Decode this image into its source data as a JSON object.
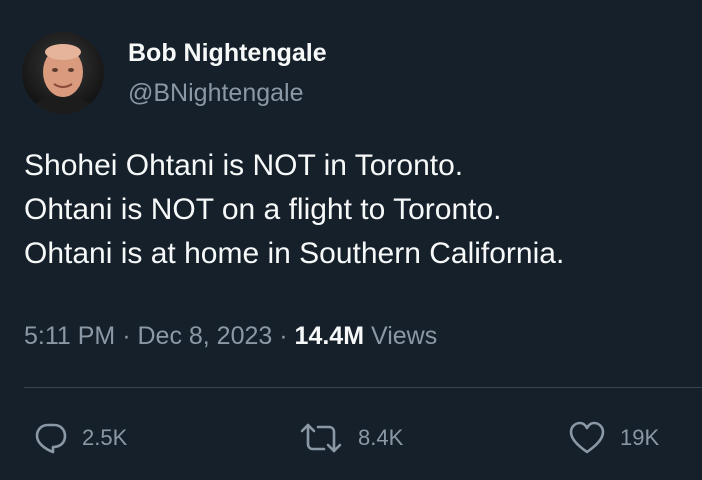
{
  "author": {
    "name": "Bob Nightengale",
    "handle": "@BNightengale"
  },
  "body": {
    "lines": [
      "Shohei Ohtani is NOT in Toronto.",
      "Ohtani is NOT on a flight to Toronto.",
      "Ohtani is at home in Southern California."
    ]
  },
  "meta": {
    "time": "5:11 PM",
    "separator": "·",
    "date": "Dec 8, 2023",
    "views_count": "14.4M",
    "views_label": "Views"
  },
  "actions": {
    "replies": "2.5K",
    "retweets": "8.4K",
    "likes": "19K"
  },
  "colors": {
    "background": "#15202b",
    "primary_text": "#f7f9f9",
    "secondary_text": "#8b98a5",
    "divider": "#38444d"
  },
  "icons": {
    "reply": "speech-bubble-icon",
    "retweet": "retweet-arrows-icon",
    "like": "heart-outline-icon"
  }
}
